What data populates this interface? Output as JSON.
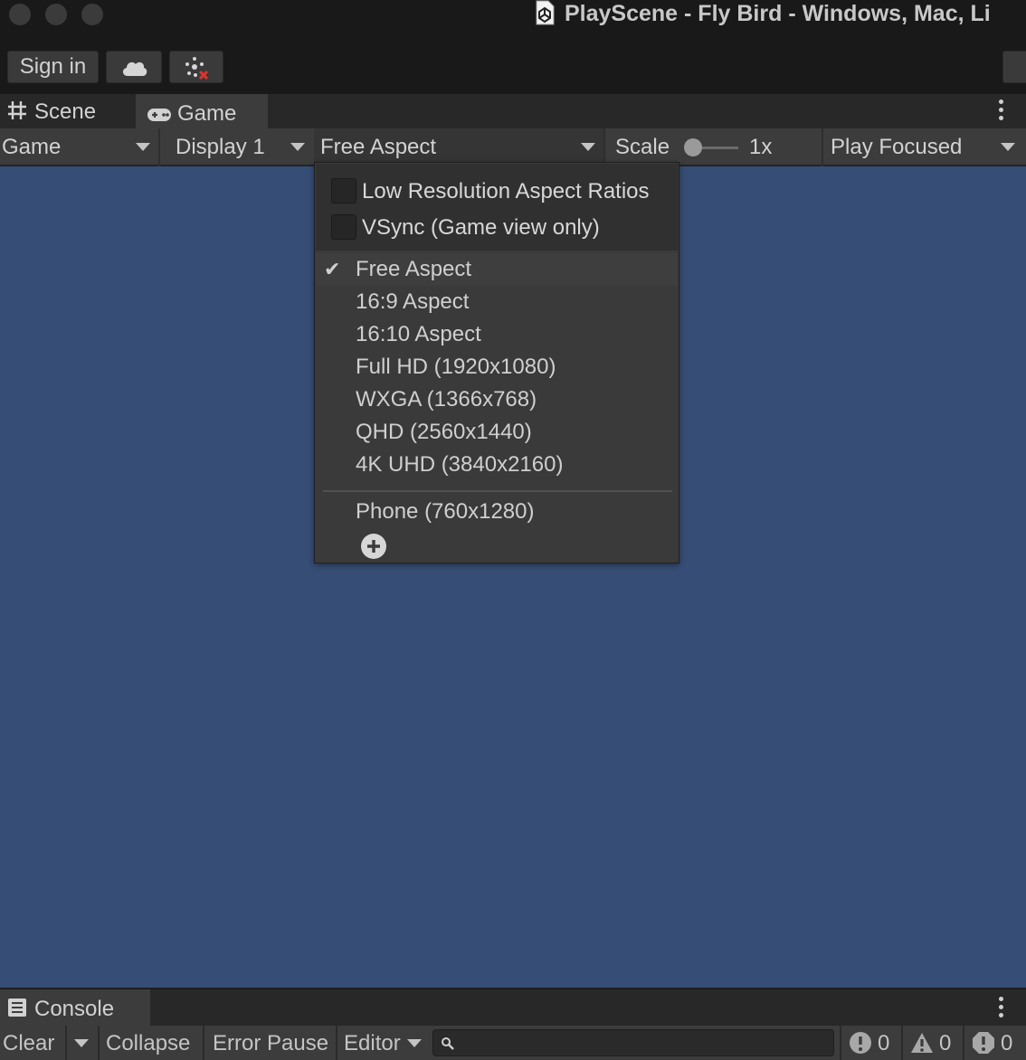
{
  "window": {
    "title": "PlayScene - Fly Bird - Windows, Mac, Li"
  },
  "toolbar": {
    "sign_in_label": "Sign in"
  },
  "tabs": {
    "scene": {
      "label": "Scene",
      "icon": "grid-icon"
    },
    "game": {
      "label": "Game",
      "icon": "gamepad-icon"
    }
  },
  "game_toolbar": {
    "view_select": "Game",
    "display_select": "Display 1",
    "aspect_select": "Free Aspect",
    "scale_label": "Scale",
    "scale_value": "1x",
    "scale_fraction": 0.0,
    "play_mode_select": "Play Focused"
  },
  "aspect_dropdown": {
    "checkboxes": [
      {
        "label": "Low Resolution Aspect Ratios",
        "checked": false
      },
      {
        "label": "VSync (Game view only)",
        "checked": false
      }
    ],
    "check_glyph": "✔",
    "options": [
      {
        "label": "Free Aspect",
        "selected": true
      },
      {
        "label": "16:9 Aspect",
        "selected": false
      },
      {
        "label": "16:10 Aspect",
        "selected": false
      },
      {
        "label": "Full HD (1920x1080)",
        "selected": false
      },
      {
        "label": "WXGA (1366x768)",
        "selected": false
      },
      {
        "label": "QHD (2560x1440)",
        "selected": false
      },
      {
        "label": "4K UHD (3840x2160)",
        "selected": false
      }
    ],
    "custom_options": [
      {
        "label": "Phone (760x1280)",
        "selected": false
      }
    ]
  },
  "console": {
    "tab_label": "Console",
    "clear_label": "Clear",
    "collapse_label": "Collapse",
    "error_pause_label": "Error Pause",
    "editor_label": "Editor",
    "search_value": "",
    "info_count": "0",
    "warning_count": "0",
    "error_count": "0"
  },
  "colors": {
    "game_background": "#364d75",
    "panel": "#3c3c3c",
    "window_chrome": "#191919"
  }
}
